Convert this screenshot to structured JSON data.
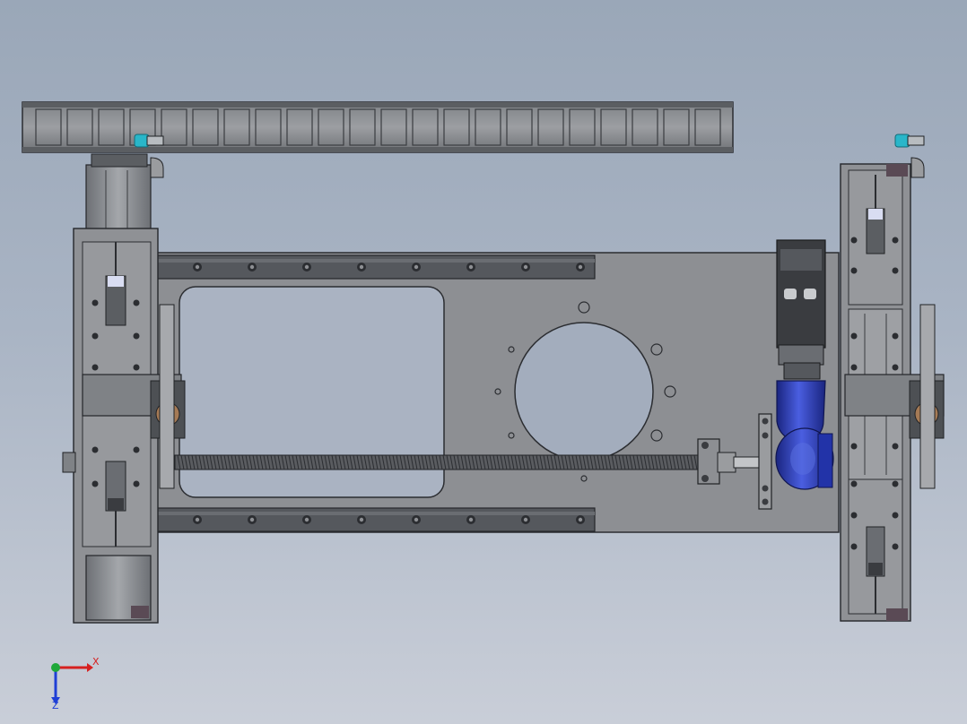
{
  "viewport": {
    "background_top": "#9aa7b8",
    "background_bottom": "#c9ced8"
  },
  "colors": {
    "plate": "#8d8f93",
    "plate_stroke": "#2b2d31",
    "rail": "#55585d",
    "cylinder": "#8a8c90",
    "motor": "#2233a8",
    "motor_highlight": "#5a6fe0",
    "fitting": "#29b6c9",
    "bushing": "#a57a55",
    "axis_x": "#d62020",
    "axis_y": "#1fa83a",
    "axis_z": "#1f3fd6"
  },
  "triad": {
    "x_label": "X",
    "z_label": "Z"
  }
}
